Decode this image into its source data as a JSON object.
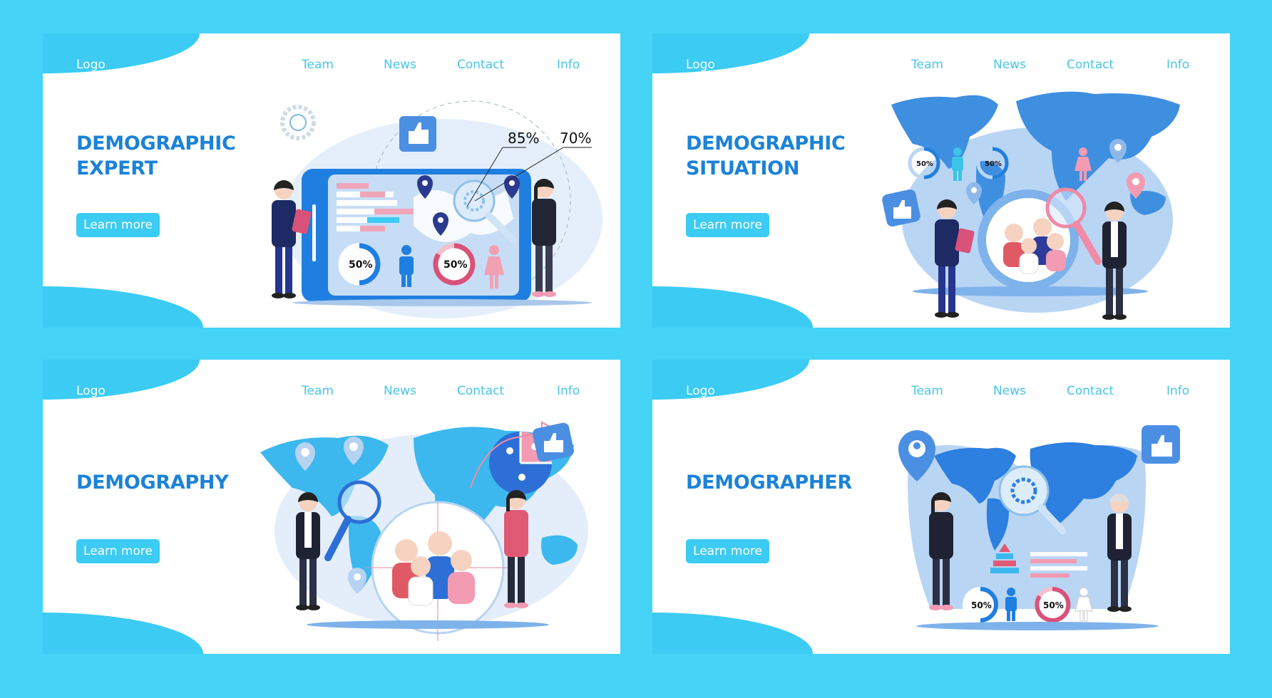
{
  "colors": {
    "background": "#45d3f8",
    "accent": "#3ccbf3",
    "title": "#1b82d8",
    "nav": "#47c6e6",
    "map": "#3f8fe0",
    "pink": "#e56f8d"
  },
  "panels": [
    {
      "logo": "Logo",
      "nav": [
        "Team",
        "News",
        "Contact",
        "Info"
      ],
      "title_lines": [
        "DEMOGRAPHIC",
        "EXPERT"
      ],
      "button": "Learn more",
      "illustration": {
        "callouts": [
          "85%",
          "70%"
        ],
        "donuts": [
          "50%",
          "50%"
        ],
        "icons": [
          "thumbs-up-icon",
          "gear-icon",
          "location-pin-icon",
          "magnifier-icon"
        ]
      }
    },
    {
      "logo": "Logo",
      "nav": [
        "Team",
        "News",
        "Contact",
        "Info"
      ],
      "title_lines": [
        "DEMOGRAPHIC",
        "SITUATION"
      ],
      "button": "Learn more",
      "illustration": {
        "donuts": [
          "50%",
          "50%"
        ],
        "icons": [
          "world-map-icon",
          "thumbs-up-icon",
          "magnifier-icon",
          "location-pin-icon"
        ]
      }
    },
    {
      "logo": "Logo",
      "nav": [
        "Team",
        "News",
        "Contact",
        "Info"
      ],
      "title_lines": [
        "DEMOGRAPHY"
      ],
      "button": "Learn more",
      "illustration": {
        "icons": [
          "world-map-icon",
          "pie-chart-icon",
          "thumbs-up-icon",
          "magnifier-icon",
          "location-pin-icon"
        ]
      }
    },
    {
      "logo": "Logo",
      "nav": [
        "Team",
        "News",
        "Contact",
        "Info"
      ],
      "title_lines": [
        "DEMOGRAPHER"
      ],
      "button": "Learn more",
      "illustration": {
        "donuts": [
          "50%",
          "50%"
        ],
        "icons": [
          "world-map-icon",
          "gear-icon",
          "thumbs-up-icon",
          "location-pin-icon",
          "pyramid-chart-icon"
        ]
      }
    }
  ]
}
